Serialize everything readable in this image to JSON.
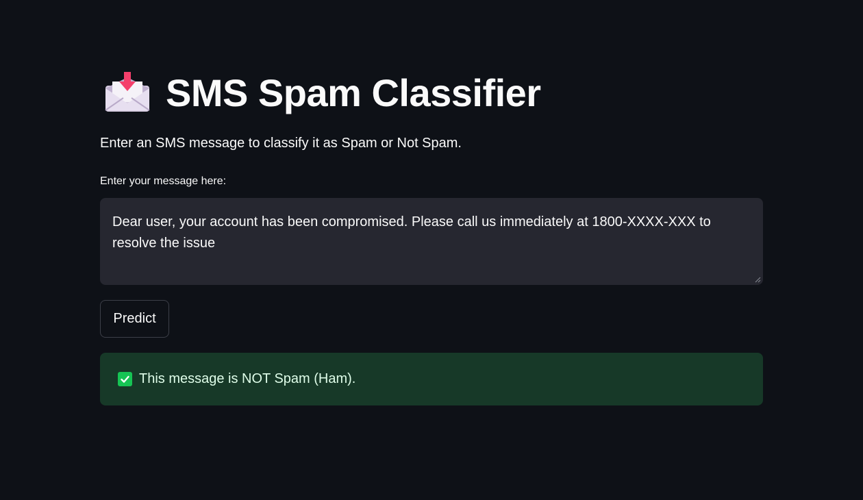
{
  "header": {
    "icon": "envelope-with-arrow-icon",
    "title": "SMS Spam Classifier"
  },
  "subtitle": "Enter an SMS message to classify it as Spam or Not Spam.",
  "message_input": {
    "label": "Enter your message here:",
    "value": "Dear user, your account has been compromised. Please call us immediately at 1800-XXXX-XXX to resolve the issue"
  },
  "predict_button": {
    "label": "Predict"
  },
  "result": {
    "icon": "check-mark-icon",
    "text": "This message is NOT Spam (Ham)."
  },
  "colors": {
    "background": "#0e1117",
    "input_background": "#262730",
    "success_background": "#173928",
    "success_text": "#dffde9",
    "check_green": "#16c454",
    "arrow_pink": "#f43f6b"
  }
}
